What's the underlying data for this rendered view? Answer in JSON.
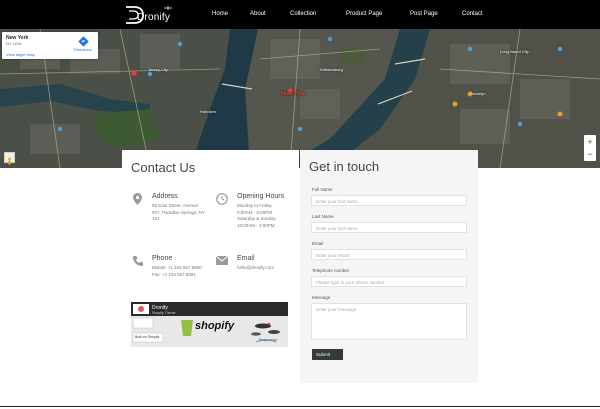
{
  "header": {
    "logo_text": "Dronify",
    "nav": [
      {
        "label": "Home"
      },
      {
        "label": "About"
      },
      {
        "label": "Collection"
      },
      {
        "label": "Product Page"
      },
      {
        "label": "Post Page"
      },
      {
        "label": "Contact"
      }
    ]
  },
  "map": {
    "card": {
      "place": "New York",
      "region": "NY, USA",
      "link": "View larger map",
      "directions": "Directions"
    },
    "red_label": "New York",
    "labels": [
      "Jersey City",
      "Williamsburg",
      "Hoboken",
      "Brooklyn",
      "Long Island City"
    ],
    "zoom_in": "+",
    "zoom_out": "−"
  },
  "contact": {
    "title": "Contact Us",
    "address": {
      "heading": "Address",
      "text": "55 East Street, Avenue #07, Paradise Springs, NY 101"
    },
    "hours": {
      "heading": "Opening Hours",
      "text": "Monday to Friday 9:00AM - 6:00PM Saturday & Sunday 10:00AM - 3:00PM"
    },
    "phone": {
      "heading": "Phone",
      "text": "Mobile: +1 234 567 8890 Fax: +1 234 567 8891"
    },
    "email": {
      "heading": "Email",
      "text": "hello@dronify.com"
    },
    "banner": {
      "brand": "Dronify",
      "sub": "Shopify Theme",
      "shopify": "shopify",
      "badge": "Built on Shopify",
      "tag": "Responsive"
    }
  },
  "form": {
    "title": "Get in touch",
    "fields": [
      {
        "label": "Full Name",
        "placeholder": "Enter your first name"
      },
      {
        "label": "Last Name",
        "placeholder": "Enter your last name"
      },
      {
        "label": "Email",
        "placeholder": "Enter your email"
      },
      {
        "label": "Telephone number",
        "placeholder": "Please type in your phone number"
      }
    ],
    "message_label": "Message",
    "message_placeholder": "Enter your message",
    "submit": "Submit"
  }
}
